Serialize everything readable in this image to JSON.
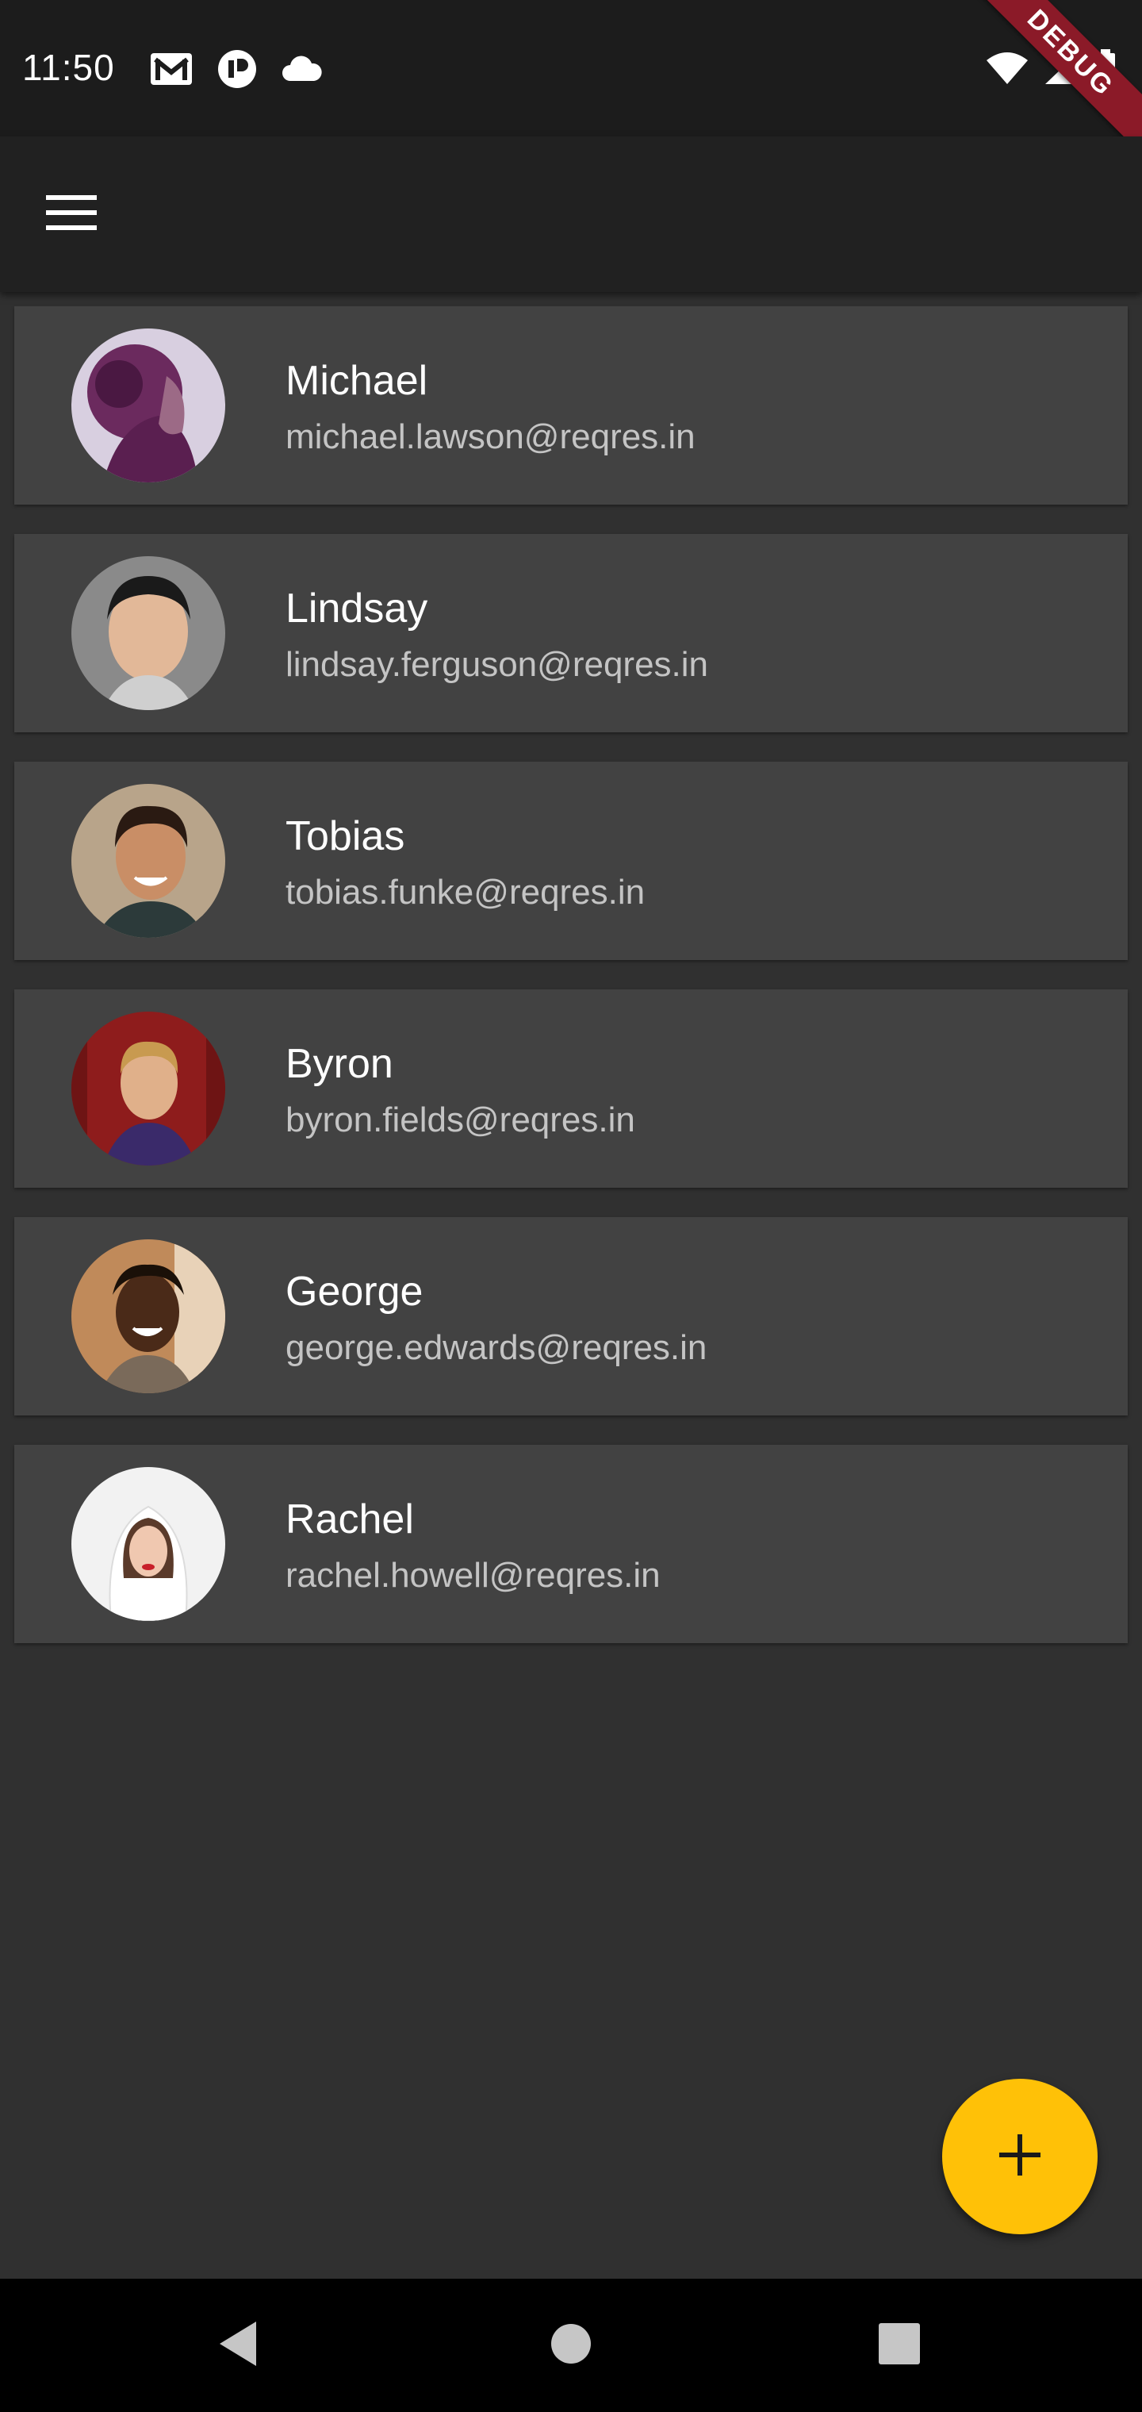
{
  "status_bar": {
    "time": "11:50",
    "left_icons": [
      "gmail-icon",
      "app-icon",
      "cloud-icon"
    ],
    "right_icons": [
      "wifi-icon",
      "signal-icon",
      "battery-icon"
    ]
  },
  "debug_banner": {
    "label": "DEBUG"
  },
  "app_bar": {
    "menu_icon": "menu-icon"
  },
  "users": [
    {
      "name": "Michael",
      "email": "michael.lawson@reqres.in"
    },
    {
      "name": "Lindsay",
      "email": "lindsay.ferguson@reqres.in"
    },
    {
      "name": "Tobias",
      "email": "tobias.funke@reqres.in"
    },
    {
      "name": "Byron",
      "email": "byron.fields@reqres.in"
    },
    {
      "name": "George",
      "email": "george.edwards@reqres.in"
    },
    {
      "name": "Rachel",
      "email": "rachel.howell@reqres.in"
    }
  ],
  "fab": {
    "icon": "plus-icon"
  },
  "nav_bar": {
    "buttons": [
      "back-icon",
      "home-icon",
      "recents-icon"
    ]
  },
  "colors": {
    "background": "#303030",
    "card": "#424242",
    "app_bar": "#212121",
    "fab": "#ffc107",
    "debug_banner": "#8b1a28"
  }
}
